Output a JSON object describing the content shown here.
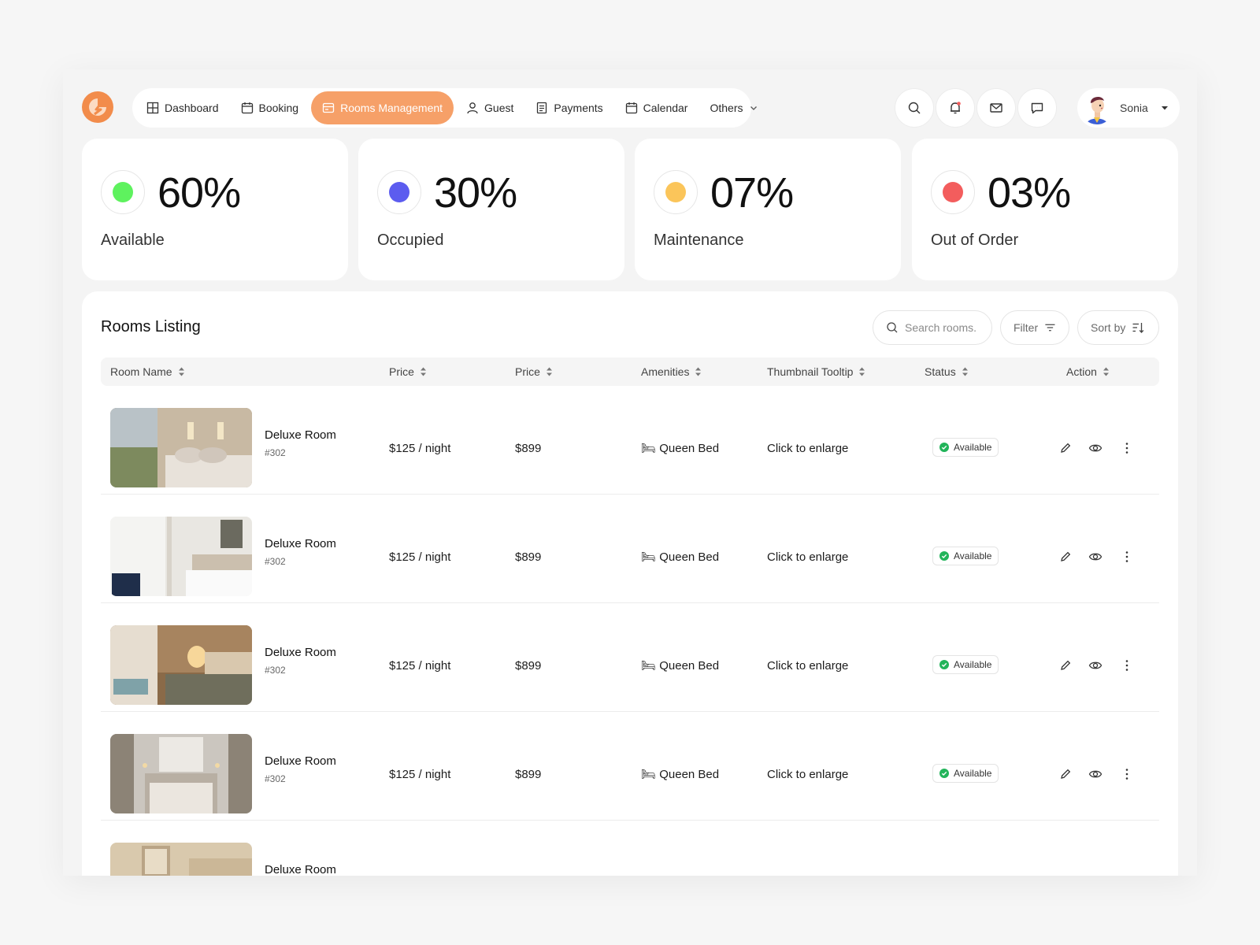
{
  "nav": {
    "items": [
      {
        "label": "Dashboard",
        "icon": "grid-icon"
      },
      {
        "label": "Booking",
        "icon": "calendar-icon"
      },
      {
        "label": "Rooms Management",
        "icon": "card-icon"
      },
      {
        "label": "Guest",
        "icon": "user-icon"
      },
      {
        "label": "Payments",
        "icon": "receipt-icon"
      },
      {
        "label": "Calendar",
        "icon": "calendar-icon"
      },
      {
        "label": "Others",
        "icon": "chevron-down-icon"
      }
    ],
    "active": "Rooms Management",
    "accent": "#f6a068"
  },
  "profile": {
    "name": "Sonia"
  },
  "stats": [
    {
      "value": "60%",
      "label": "Available",
      "color": "#5ef25e"
    },
    {
      "value": "30%",
      "label": "Occupied",
      "color": "#5c5cef"
    },
    {
      "value": "07%",
      "label": "Maintenance",
      "color": "#fbc55a"
    },
    {
      "value": "03%",
      "label": "Out of Order",
      "color": "#f35d5d"
    }
  ],
  "listing": {
    "title": "Rooms Listing",
    "search_placeholder": "Search rooms...",
    "filter_label": "Filter",
    "sort_label": "Sort by",
    "columns": [
      "Room Name",
      "Price",
      "Price",
      "Amenities",
      "Thumbnail Tooltip",
      "Status",
      "Action"
    ],
    "rows": [
      {
        "name": "Deluxe Room",
        "number": "#302",
        "price_night": "$125 / night",
        "price": "$899",
        "amenities": "🛏 Queen Bed",
        "tooltip": "Click to enlarge",
        "status": "Available"
      },
      {
        "name": "Deluxe Room",
        "number": "#302",
        "price_night": "$125 / night",
        "price": "$899",
        "amenities": "🛏 Queen Bed",
        "tooltip": "Click to enlarge",
        "status": "Available"
      },
      {
        "name": "Deluxe Room",
        "number": "#302",
        "price_night": "$125 / night",
        "price": "$899",
        "amenities": "🛏 Queen Bed",
        "tooltip": "Click to enlarge",
        "status": "Available"
      },
      {
        "name": "Deluxe Room",
        "number": "#302",
        "price_night": "$125 / night",
        "price": "$899",
        "amenities": "🛏 Queen Bed",
        "tooltip": "Click to enlarge",
        "status": "Available"
      },
      {
        "name": "Deluxe Room",
        "number": "",
        "price_night": "",
        "price": "",
        "amenities": "",
        "tooltip": "",
        "status": ""
      }
    ]
  }
}
